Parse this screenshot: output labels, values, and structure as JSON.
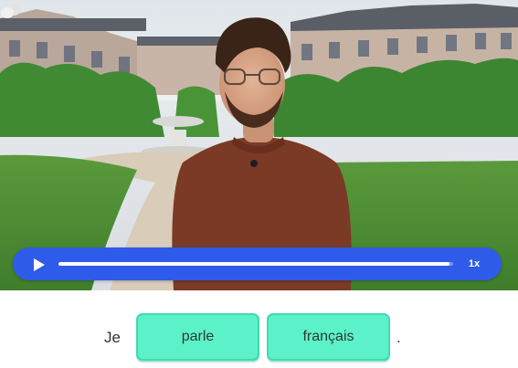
{
  "player": {
    "speed_label": "1x",
    "progress_fraction": 0.99,
    "accent_color": "#2f5bea"
  },
  "sentence": {
    "prefix": "Je",
    "blanks": [
      "parle",
      "français"
    ],
    "suffix": "."
  },
  "colors": {
    "chip_fill": "#5cf2c9",
    "chip_border": "#3fd9b0"
  },
  "icons": {
    "play": "play-icon",
    "chat": "chat-bubble-icon"
  }
}
